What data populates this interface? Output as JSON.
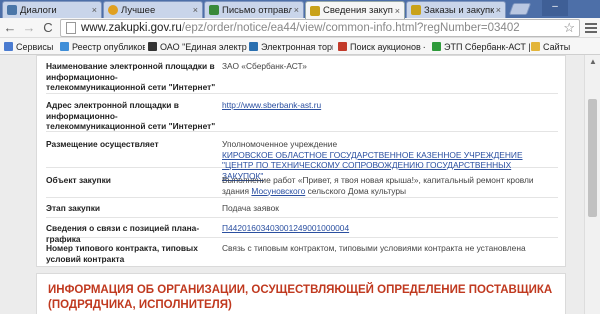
{
  "browser": {
    "tabs": [
      {
        "label": "Диалоги",
        "icon_color": "#4a76a8"
      },
      {
        "label": "Лучшее",
        "icon_color": "#e0a020"
      },
      {
        "label": "Письмо отправле",
        "icon_color": "#3a8a3a"
      },
      {
        "label": "Сведения закупк",
        "icon_color": "#c9a21a"
      },
      {
        "label": "Заказы и закупки",
        "icon_color": "#c9a21a"
      }
    ],
    "tab_close": "×",
    "url_host": "www.zakupki.gov.ru",
    "url_path": "/epz/order/notice/ea44/view/common-info.html?regNumber=03402",
    "star": "☆",
    "back": "←",
    "forward": "→",
    "reload": "C",
    "minimize": "–"
  },
  "bookmarks": [
    {
      "label": "Сервисы",
      "icon_color": "#4a7bd0"
    },
    {
      "label": "Реестр опубликован",
      "icon_color": "#3f8ed8"
    },
    {
      "label": "ОАО \"Единая электр",
      "icon_color": "#333333"
    },
    {
      "label": "Электронная торгов",
      "icon_color": "#2a6fb0"
    },
    {
      "label": "Поиск аукционов - F",
      "icon_color": "#c23a2a"
    },
    {
      "label": "ЭТП Сбербанк-АСТ |",
      "icon_color": "#2e9a3a"
    },
    {
      "label": "Сайты",
      "icon_color": "#e3b53a"
    }
  ],
  "main": {
    "rows": [
      {
        "label": "Наименование электронной площадки в информационно-телекоммуникационной сети \"Интернет\"",
        "value": "ЗАО «Сбербанк-АСТ»"
      },
      {
        "label": "Адрес электронной площадки в информационно-телекоммуникационной сети \"Интернет\"",
        "value": "http://www.sberbank-ast.ru"
      },
      {
        "label": "Размещение осуществляет",
        "value": "Уполномоченное учреждение",
        "link": "КИРОВСКОЕ ОБЛАСТНОЕ ГОСУДАРСТВЕННОЕ КАЗЕННОЕ УЧРЕЖДЕНИЕ \"ЦЕНТР ПО ТЕХНИЧЕСКОМУ СОПРОВОЖДЕНИЮ ГОСУДАРСТВЕННЫХ ЗАКУПОК\""
      },
      {
        "label": "Объект закупки",
        "value_pre": "Выполнение работ «Привет, я твоя новая крыша!», капитальный ремонт кровли здания ",
        "value_link": "Мосуновского",
        "value_post": " сельского Дома культуры"
      },
      {
        "label": "Этап закупки",
        "value": "Подача заявок"
      },
      {
        "label": "Сведения о связи с позицией плана-графика",
        "value": "П44201603403001249001000004"
      },
      {
        "label": "Номер типового контракта, типовых условий контракта",
        "value": "Связь с типовым контрактом, типовыми условиями контракта не установлена"
      }
    ],
    "section_heading": "ИНФОРМАЦИЯ ОБ ОРГАНИЗАЦИИ, ОСУЩЕСТВЛЯЮЩЕЙ ОПРЕДЕЛЕНИЕ ПОСТАВЩИКА (ПОДРЯДЧИКА, ИСПОЛНИТЕЛЯ)"
  },
  "colors": {
    "tabstrip": "#4d6fa8",
    "link": "#2a4fa0",
    "heading": "#c0391f"
  }
}
